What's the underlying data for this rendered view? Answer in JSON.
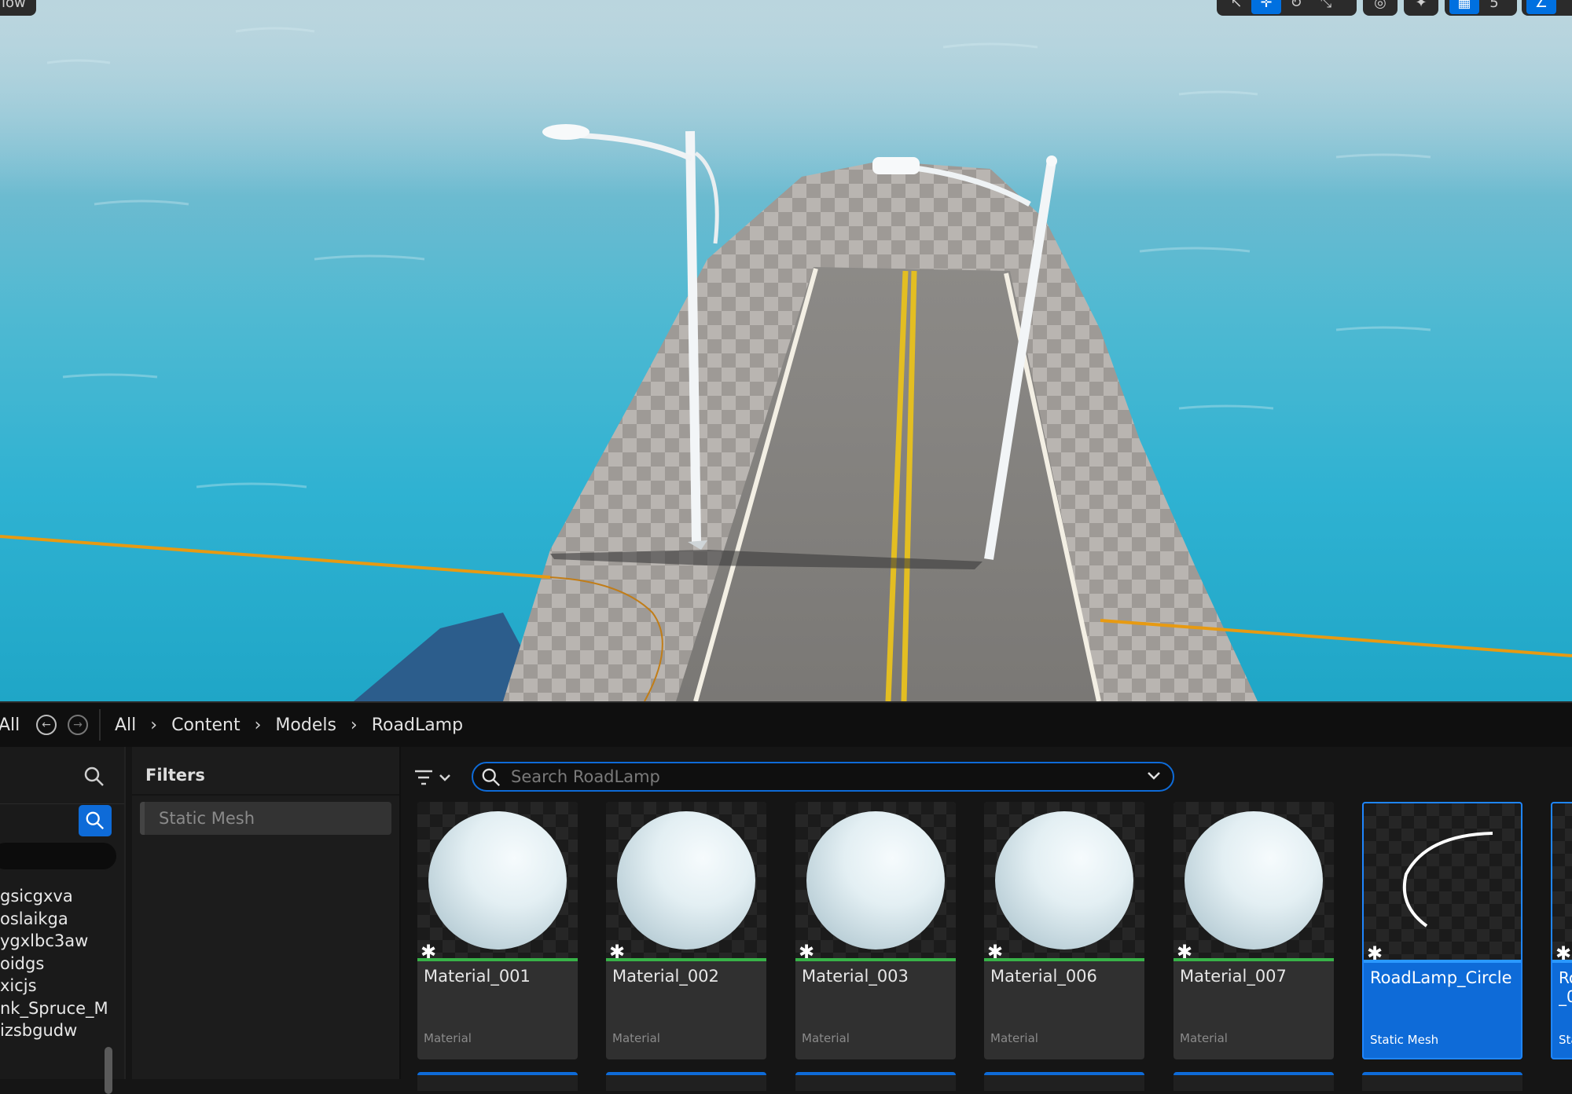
{
  "viewport": {
    "left_pill_label": "low",
    "toolbar_icons": [
      "select-icon",
      "translate-icon",
      "rotate-icon",
      "scale-icon",
      "world-icon",
      "snap-icon",
      "grid-icon",
      "grid-value-icon",
      "angle-icon"
    ],
    "grid_value": "5"
  },
  "breadcrumb": {
    "left_label": "All",
    "items": [
      "All",
      "Content",
      "Models",
      "RoadLamp"
    ]
  },
  "sources": {
    "items": [
      "gsicgxva",
      "oslaikga",
      "ygxlbc3aw",
      "oidgs",
      "xicjs",
      "nk_Spruce_M",
      "izsbgudw"
    ]
  },
  "filters": {
    "title": "Filters",
    "chips": [
      "Static Mesh"
    ]
  },
  "asset_search": {
    "placeholder": "Search RoadLamp"
  },
  "assets": [
    {
      "name": "Material_001",
      "type": "Material",
      "thumb": "sphere"
    },
    {
      "name": "Material_002",
      "type": "Material",
      "thumb": "sphere"
    },
    {
      "name": "Material_003",
      "type": "Material",
      "thumb": "sphere"
    },
    {
      "name": "Material_006",
      "type": "Material",
      "thumb": "sphere"
    },
    {
      "name": "Material_007",
      "type": "Material",
      "thumb": "sphere"
    },
    {
      "name": "RoadLamp_Circle",
      "type": "Static Mesh",
      "thumb": "arc",
      "selected": true
    },
    {
      "name": "Ro _0",
      "type": "Sta",
      "thumb": "partial",
      "selected": true
    }
  ],
  "colors": {
    "accent": "#0e6bd8",
    "material_underline": "#38b248",
    "water": "#2fb2d2",
    "spline": "#e79a12"
  }
}
